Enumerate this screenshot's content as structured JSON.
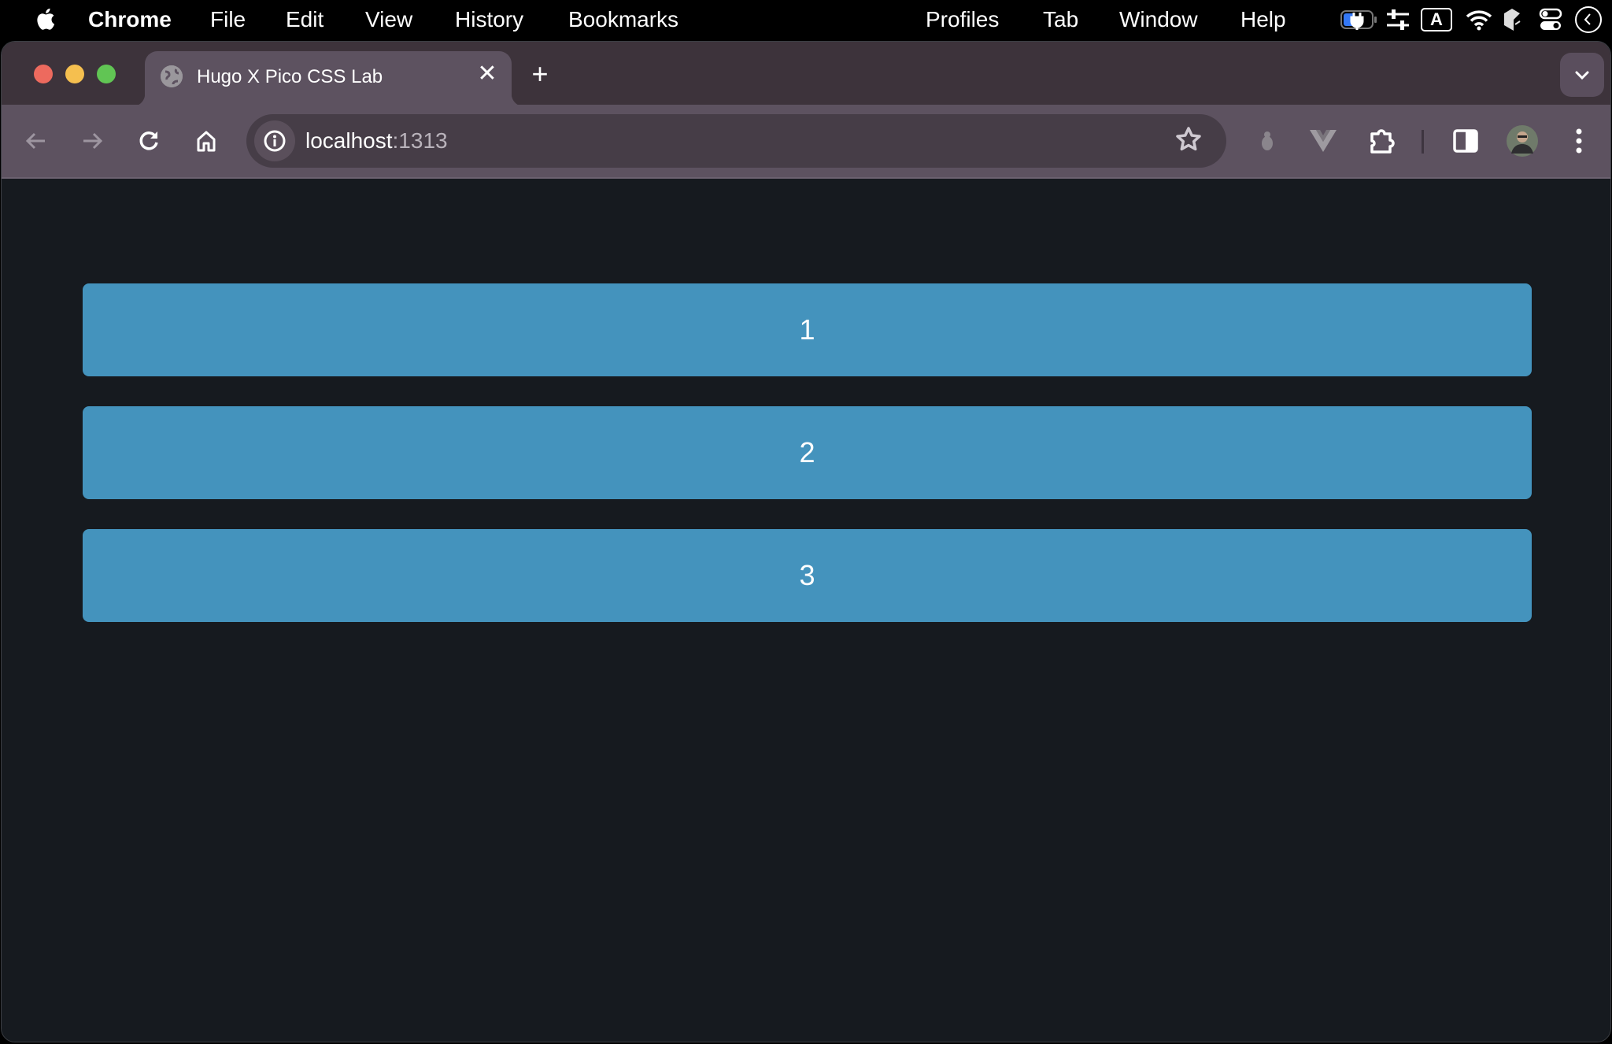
{
  "menubar": {
    "app_name": "Chrome",
    "items": [
      "File",
      "Edit",
      "View",
      "History",
      "Bookmarks",
      "Profiles",
      "Tab",
      "Window",
      "Help"
    ],
    "status_icons": [
      "battery-charging-icon",
      "control-sliders-icon",
      "input-source-icon",
      "wifi-icon",
      "app-status-icon",
      "control-center-icon",
      "clock-icon"
    ],
    "input_source_letter": "A"
  },
  "browser": {
    "tab": {
      "title": "Hugo X Pico CSS Lab",
      "close_glyph": "✕"
    },
    "new_tab_glyph": "+",
    "address": {
      "host": "localhost",
      "port": ":1313"
    },
    "traffic_lights": {
      "close": "#ed6a5e",
      "minimize": "#f5bf4f",
      "maximize": "#61c554"
    }
  },
  "page": {
    "blocks": [
      "1",
      "2",
      "3"
    ],
    "block_color": "#4493bd",
    "background_color": "#161a1f"
  }
}
